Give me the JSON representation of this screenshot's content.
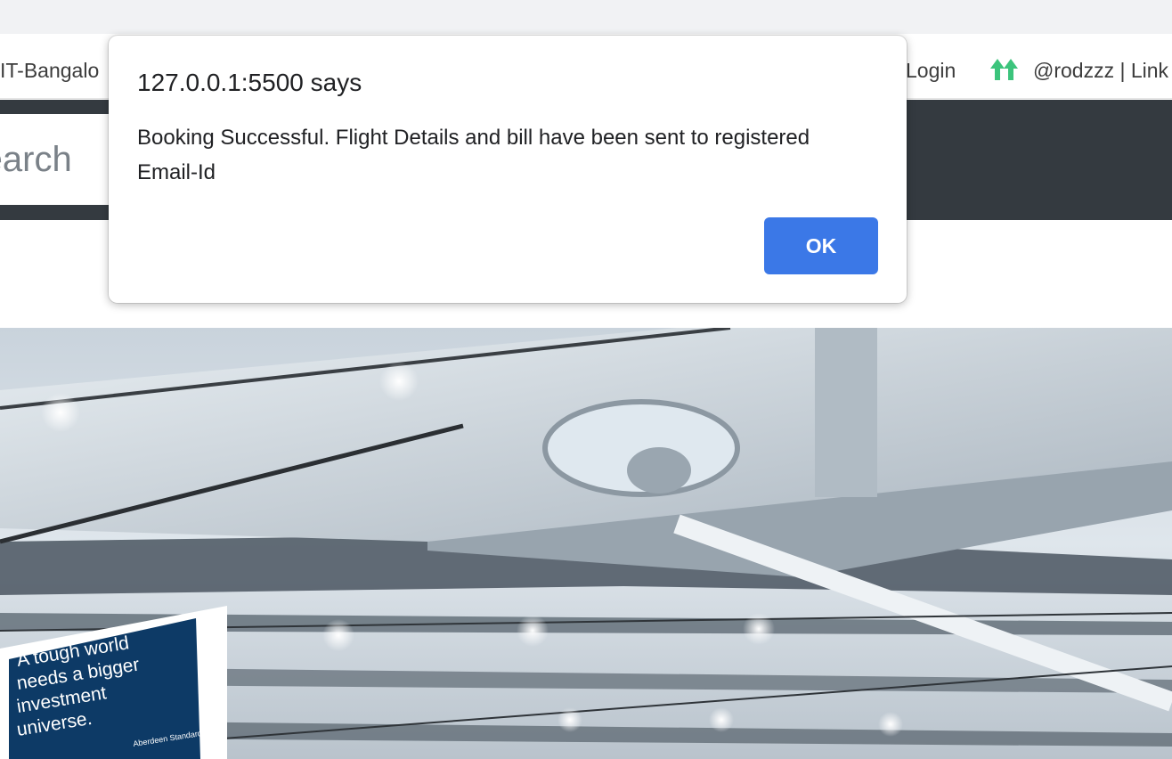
{
  "bookmarks": {
    "left_label": "IT-Bangalo",
    "login_label": "Login",
    "profile_label": "@rodzzz | Link"
  },
  "navbar": {
    "search_placeholder": "Search"
  },
  "hero": {
    "sign_text": "A tough world needs a bigger investment universe.",
    "sign_brand": "Aberdeen Standard"
  },
  "dialog": {
    "title": "127.0.0.1:5500 says",
    "message": "Booking Successful. Flight Details and bill have been sent to registered Email-Id",
    "ok_label": "OK"
  },
  "colors": {
    "navbar": "#343a40",
    "ok_button": "#3b78e7",
    "bookmark_icon": "#3cc47c"
  }
}
